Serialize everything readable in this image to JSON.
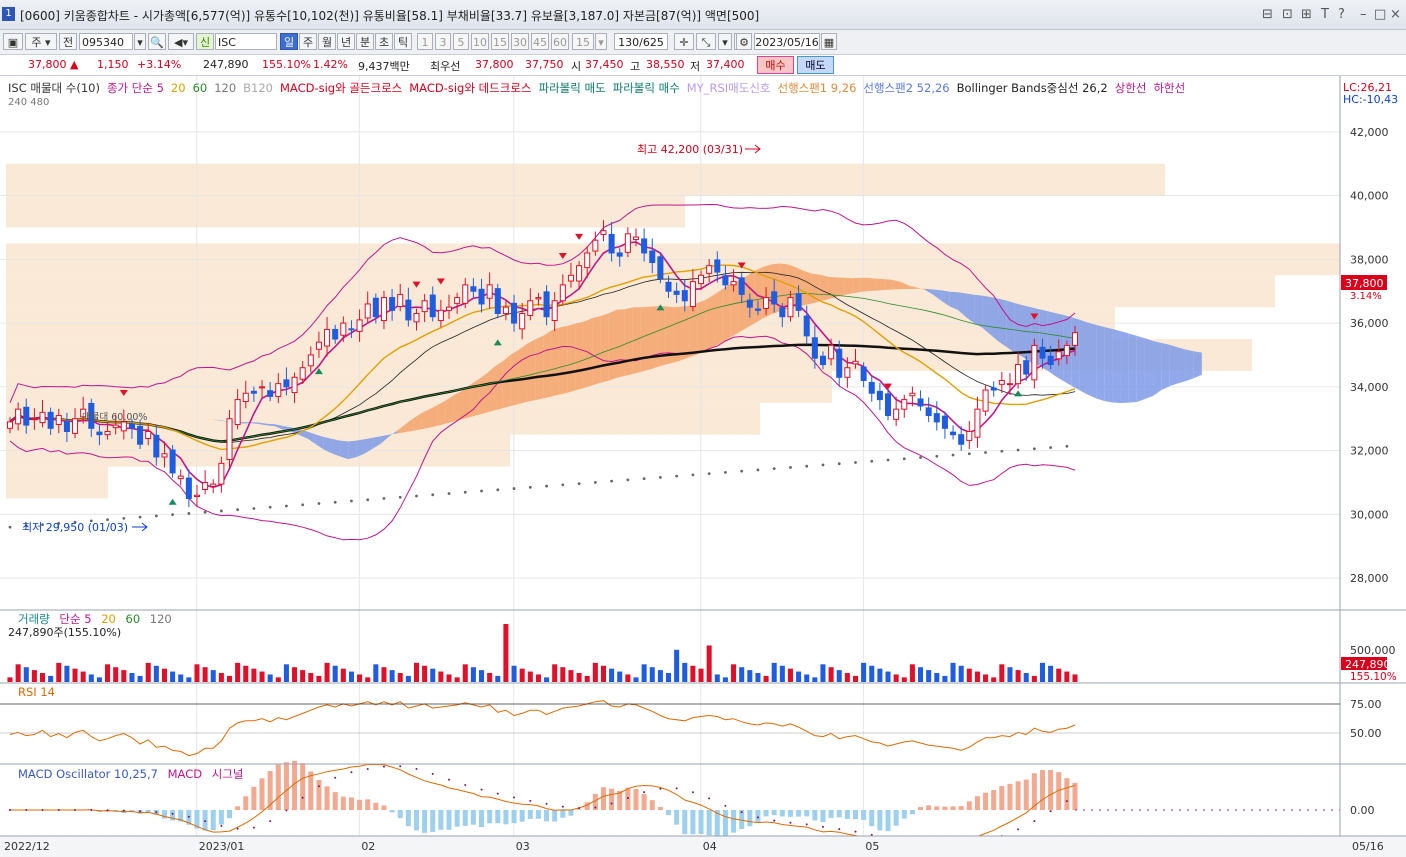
{
  "window": {
    "num": "1",
    "title": "[0600] 키움종합차트 - 시가총액[6,577(억)] 유통수[10,102(천)] 유통비율[58.1] 부채비율[33.7] 유보율[3,187.0] 자본금[87(억)] 액면[500]",
    "buttons": [
      "⊟",
      "⊡",
      "⊞",
      "T",
      "?",
      "–",
      "□",
      "×"
    ]
  },
  "toolbar": {
    "period": "주",
    "prev": "전",
    "code": "095340",
    "credit": "신",
    "name": "ISC",
    "intervals": [
      "일",
      "주",
      "월",
      "년",
      "분",
      "초",
      "틱"
    ],
    "minutes": [
      "1",
      "3",
      "5",
      "10",
      "15",
      "30",
      "45",
      "60"
    ],
    "custom": "15",
    "count": "130/625",
    "date": "2023/05/16"
  },
  "price": {
    "current": "37,800",
    "change": "1,150",
    "change_pct": "+3.14%",
    "volume": "247,890",
    "volume_ratio": "155.10%",
    "turnover": "1.42%",
    "amount": "9,437백만",
    "best_label": "최우선",
    "best_ask": "37,800",
    "best_bid": "37,750",
    "open_label": "시",
    "open": "37,450",
    "high_label": "고",
    "high": "38,550",
    "low_label": "저",
    "low": "37,400",
    "buy": "매수",
    "sell": "매도"
  },
  "legend": {
    "main": [
      {
        "text": "ISC 매물대 수(10)",
        "color": "#333333"
      },
      {
        "text": "종가 단순 5",
        "color": "#c0168e"
      },
      {
        "text": "20",
        "color": "#e0a000"
      },
      {
        "text": "60",
        "color": "#2a8a2a"
      },
      {
        "text": "120",
        "color": "#777777"
      },
      {
        "text": "B120",
        "color": "#aaaaaa"
      },
      {
        "text": "MACD-sig와 골든크로스",
        "color": "#d8001b"
      },
      {
        "text": "MACD-sig와 데드크로스",
        "color": "#d8001b"
      },
      {
        "text": "파라볼릭 매도",
        "color": "#0a7a6a"
      },
      {
        "text": "파라볼릭 매수",
        "color": "#0a7a6a"
      },
      {
        "text": "MY_RSI매도신호",
        "color": "#b99bf0"
      },
      {
        "text": "선행스팬1 9,26",
        "color": "#e08a3a"
      },
      {
        "text": "선행스팬2 52,26",
        "color": "#5a7ae0"
      },
      {
        "text": "Bollinger Bands중심선 26,2",
        "color": "#222222"
      },
      {
        "text": "상한선",
        "color": "#c0168e"
      },
      {
        "text": "하한선",
        "color": "#c0168e"
      }
    ],
    "row2": "240  480",
    "lc": "LC:26,21",
    "hc": "HC:-10,43"
  },
  "annotations": {
    "high": "최고 42,200 (03/31)",
    "low": "최저 29,950 (01/03)",
    "vp_label": "매물대 60.00%"
  },
  "y_axis": {
    "price_ticks": [
      "42,000",
      "40,000",
      "38,000",
      "36,000",
      "34,000",
      "32,000",
      "30,000",
      "28,000"
    ],
    "current_tag": "37,800",
    "current_pct": "3.14%",
    "volume_ticks": [
      "500,000"
    ],
    "volume_tag": "247,890",
    "volume_pct": "155.10%",
    "rsi_ticks": [
      "75.00",
      "50.00"
    ],
    "macd_ticks": [
      "0.00"
    ]
  },
  "x_axis": {
    "labels": [
      "2022/12",
      "2023/01",
      "02",
      "03",
      "04",
      "05"
    ],
    "end": "05/16"
  },
  "volume_panel": {
    "title": "거래량",
    "ma": "단순 5",
    "p20": "20",
    "p60": "60",
    "p120": "120",
    "info": "247,890주(155.10%)"
  },
  "rsi_panel": {
    "title": "RSI 14"
  },
  "macd_panel": {
    "title": "MACD Oscillator 10,25,7",
    "macd": "MACD",
    "signal": "시그널"
  },
  "chart_data": {
    "type": "candlestick",
    "x_start": "2022-12-01",
    "bars": 130,
    "ylim": [
      27000,
      43500
    ],
    "series": [
      {
        "name": "종가",
        "values": [
          32900,
          33300,
          32800,
          33000,
          33200,
          32700,
          33100,
          32600,
          33000,
          33300,
          32700,
          32500,
          32600,
          32800,
          32900,
          32700,
          32200,
          32600,
          31800,
          31900,
          31300,
          31200,
          30500,
          30600,
          31000,
          30950,
          31600,
          33000,
          33600,
          33800,
          33800,
          34000,
          33700,
          34100,
          34000,
          34300,
          34600,
          35000,
          35400,
          35800,
          35500,
          36000,
          35800,
          36100,
          36600,
          36200,
          36800,
          36400,
          36900,
          36100,
          36300,
          36700,
          36200,
          36400,
          36500,
          36800,
          37200,
          37000,
          36600,
          37200,
          36300,
          36500,
          36000,
          36300,
          36700,
          36800,
          36200,
          36700,
          37200,
          37500,
          37800,
          38200,
          38600,
          38900,
          38200,
          38100,
          38800,
          38700,
          38200,
          37900,
          37400,
          37000,
          36900,
          36700,
          37300,
          37500,
          37800,
          37600,
          37200,
          37300,
          36900,
          36500,
          36400,
          36800,
          36600,
          36200,
          36800,
          36400,
          35600,
          34900,
          34700,
          35300,
          34300,
          34600,
          34800,
          34200,
          33800,
          33600,
          33100,
          33300,
          33600,
          33800,
          33400,
          33100,
          32900,
          32700,
          32500,
          32200,
          32600,
          33300,
          33900,
          33900,
          34200,
          34100,
          34700,
          34400,
          35300,
          34900,
          34700,
          35100,
          35300,
          35700
        ]
      },
      {
        "name": "RSI",
        "values": [
          46,
          48,
          45,
          46,
          50,
          44,
          47,
          43,
          48,
          50,
          44,
          40,
          42,
          45,
          47,
          43,
          37,
          41,
          34,
          35,
          31,
          30,
          26,
          28,
          33,
          33,
          40,
          52,
          57,
          59,
          59,
          61,
          58,
          62,
          60,
          63,
          66,
          69,
          72,
          74,
          72,
          75,
          73,
          75,
          77,
          74,
          77,
          74,
          77,
          71,
          73,
          75,
          71,
          72,
          73,
          74,
          76,
          74,
          72,
          74,
          67,
          69,
          64,
          66,
          69,
          69,
          65,
          68,
          71,
          72,
          73,
          75,
          77,
          78,
          73,
          72,
          75,
          74,
          71,
          68,
          64,
          61,
          60,
          59,
          62,
          63,
          64,
          63,
          60,
          61,
          58,
          56,
          55,
          57,
          56,
          54,
          56,
          53,
          49,
          45,
          44,
          47,
          42,
          44,
          45,
          42,
          39,
          38,
          35,
          37,
          39,
          40,
          38,
          36,
          35,
          34,
          33,
          31,
          34,
          39,
          43,
          43,
          45,
          44,
          48,
          46,
          52,
          49,
          48,
          51,
          52,
          55
        ]
      }
    ]
  }
}
